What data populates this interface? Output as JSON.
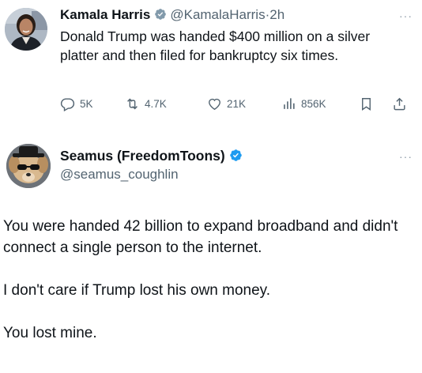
{
  "tweet1": {
    "author_name": "Kamala Harris",
    "handle": "@KamalaHarris",
    "separator": "·",
    "time": "2h",
    "more": "···",
    "text": "Donald Trump was handed $400 million on a silver platter and then filed for bankruptcy six times.",
    "stats": {
      "replies": "5K",
      "retweets": "4.7K",
      "likes": "21K",
      "views": "856K"
    },
    "icons": [
      "reply-icon",
      "retweet-icon",
      "like-icon",
      "views-icon",
      "bookmark-icon",
      "share-icon"
    ],
    "verified_badge_color": "#829aab"
  },
  "tweet2": {
    "author_name": "Seamus (FreedomToons)",
    "handle": "@seamus_coughlin",
    "more": "···",
    "paragraphs": [
      "You were handed 42 billion to expand broadband and didn't connect a single person to the internet.",
      "I don't care if Trump lost his own money.",
      "You lost mine."
    ],
    "verified_badge_color": "#1d9bf0"
  },
  "colors": {
    "text_primary": "#0f1419",
    "text_secondary": "#536471"
  }
}
